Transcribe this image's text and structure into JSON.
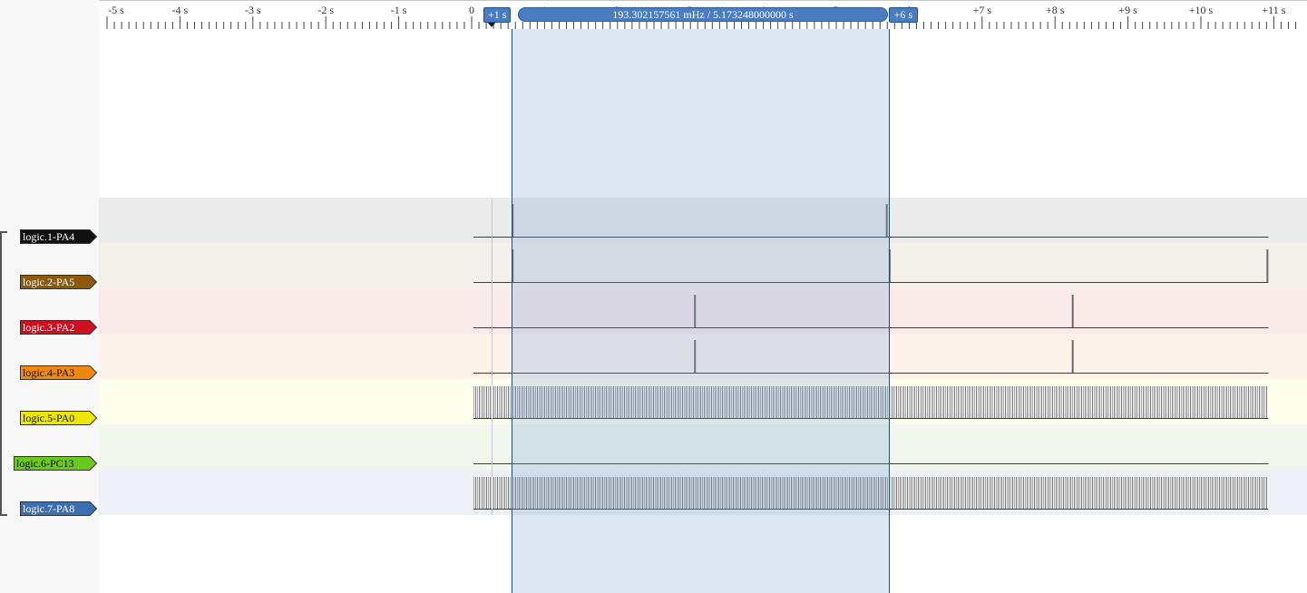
{
  "ruler": {
    "ticks": [
      "-5 s",
      "-4 s",
      "-3 s",
      "-2 s",
      "-1 s",
      "0",
      "+1 s",
      "+2 s",
      "+3 s",
      "+4 s",
      "+5 s",
      "+6 s",
      "+7 s",
      "+8 s",
      "+9 s",
      "+10 s",
      "+11 s"
    ],
    "range_seconds": [
      -5,
      11
    ]
  },
  "cursors": {
    "start_label": "+1 s",
    "end_label": "+6 s",
    "readout": "193.302157561 mHz / 5.173248000000 s",
    "start_time_s": 0.55,
    "end_time_s": 5.72,
    "fill_color": "#dbe6f3",
    "tag_color": "#4a7dc0"
  },
  "trigger_time_s": 0.27,
  "trace_color": "#cc0000",
  "channels": [
    {
      "label": "logic.1-PA4",
      "color": "#111111",
      "text_color": "#ffffff",
      "bg": "#ebebeb",
      "pulses_s": [
        0.55,
        5.68
      ]
    },
    {
      "label": "logic.2-PA5",
      "color": "#8a5a0e",
      "text_color": "#ffffff",
      "bg": "#f3f0eb",
      "pulses_s": [
        0.55,
        5.72,
        10.9
      ]
    },
    {
      "label": "logic.3-PA2",
      "color": "#cc1020",
      "text_color": "#ffffff",
      "bg": "#fbeaea",
      "pulses_s": [
        3.05,
        8.23
      ]
    },
    {
      "label": "logic.4-PA3",
      "color": "#f08810",
      "text_color": "#111111",
      "bg": "#fdf3eb",
      "pulses_s": [
        3.05,
        8.23
      ]
    },
    {
      "label": "logic.5-PA0",
      "color": "#ede700",
      "text_color": "#111111",
      "bg": "#fdfdeb",
      "dense": true
    },
    {
      "label": "logic.6-PC13",
      "color": "#6bc81e",
      "text_color": "#111111",
      "bg": "#f1f7eb",
      "pulses_s": []
    },
    {
      "label": "logic.7-PA8",
      "color": "#3c6fb0",
      "text_color": "#ffffff",
      "bg": "#edf1f7",
      "dense": true
    }
  ]
}
